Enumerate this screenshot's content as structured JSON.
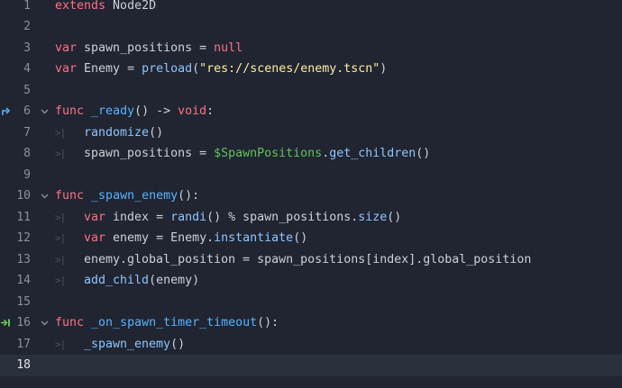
{
  "editor": {
    "lines": [
      {
        "n": "1",
        "parts": [
          [
            "kw",
            "extends"
          ],
          [
            "plain",
            " Node2D"
          ]
        ]
      },
      {
        "n": "2",
        "parts": []
      },
      {
        "n": "3",
        "parts": [
          [
            "kw",
            "var"
          ],
          [
            "plain",
            " spawn_positions = "
          ],
          [
            "kw",
            "null"
          ]
        ]
      },
      {
        "n": "4",
        "parts": [
          [
            "kw",
            "var"
          ],
          [
            "plain",
            " Enemy = "
          ],
          [
            "call",
            "preload"
          ],
          [
            "plain",
            "("
          ],
          [
            "str",
            "\"res://scenes/enemy.tscn\""
          ],
          [
            "plain",
            ")"
          ]
        ]
      },
      {
        "n": "5",
        "parts": []
      },
      {
        "n": "6",
        "fold": true,
        "icon": "override-arrow-icon",
        "parts": [
          [
            "kw",
            "func"
          ],
          [
            "plain",
            " "
          ],
          [
            "fn",
            "_ready"
          ],
          [
            "plain",
            "() -> "
          ],
          [
            "kw",
            "void"
          ],
          [
            "plain",
            ":"
          ]
        ]
      },
      {
        "n": "7",
        "indent": true,
        "parts": [
          [
            "call",
            "randomize"
          ],
          [
            "plain",
            "()"
          ]
        ]
      },
      {
        "n": "8",
        "indent": true,
        "parts": [
          [
            "plain",
            "spawn_positions = "
          ],
          [
            "node",
            "$SpawnPositions"
          ],
          [
            "plain",
            "."
          ],
          [
            "call",
            "get_children"
          ],
          [
            "plain",
            "()"
          ]
        ]
      },
      {
        "n": "9",
        "parts": []
      },
      {
        "n": "10",
        "fold": true,
        "parts": [
          [
            "kw",
            "func"
          ],
          [
            "plain",
            " "
          ],
          [
            "fn",
            "_spawn_enemy"
          ],
          [
            "plain",
            "():"
          ]
        ]
      },
      {
        "n": "11",
        "indent": true,
        "parts": [
          [
            "kw",
            "var"
          ],
          [
            "plain",
            " index = "
          ],
          [
            "call",
            "randi"
          ],
          [
            "plain",
            "() % spawn_positions."
          ],
          [
            "call",
            "size"
          ],
          [
            "plain",
            "()"
          ]
        ]
      },
      {
        "n": "12",
        "indent": true,
        "parts": [
          [
            "kw",
            "var"
          ],
          [
            "plain",
            " enemy = Enemy."
          ],
          [
            "call",
            "instantiate"
          ],
          [
            "plain",
            "()"
          ]
        ]
      },
      {
        "n": "13",
        "indent": true,
        "parts": [
          [
            "plain",
            "enemy.global_position = spawn_positions[index].global_position"
          ]
        ]
      },
      {
        "n": "14",
        "indent": true,
        "parts": [
          [
            "call",
            "add_child"
          ],
          [
            "plain",
            "(enemy)"
          ]
        ]
      },
      {
        "n": "15",
        "parts": []
      },
      {
        "n": "16",
        "fold": true,
        "icon": "signal-connection-icon",
        "parts": [
          [
            "kw",
            "func"
          ],
          [
            "plain",
            " "
          ],
          [
            "fn",
            "_on_spawn_timer_timeout"
          ],
          [
            "plain",
            "():"
          ]
        ]
      },
      {
        "n": "17",
        "indent": true,
        "parts": [
          [
            "call",
            "_spawn_enemy"
          ],
          [
            "plain",
            "()"
          ]
        ]
      },
      {
        "n": "18",
        "current": true,
        "parts": []
      }
    ],
    "tab_marker": ">|",
    "colors": {
      "background": "#202531",
      "current_line": "#2a303c",
      "keyword": "#ff7085",
      "function_name": "#57b3ff",
      "call": "#8fc5ff",
      "string": "#ffeda1",
      "node_path": "#63c259",
      "icon_blue": "#57b3ff",
      "icon_green": "#63c259"
    }
  }
}
